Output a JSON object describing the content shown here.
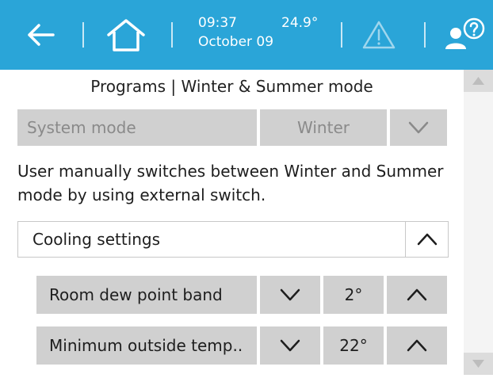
{
  "topbar": {
    "time": "09:37",
    "temperature": "24.9°",
    "date": "October 09",
    "background": "#2aa5d8"
  },
  "page_title": "Programs | Winter & Summer mode",
  "system_mode": {
    "label": "System mode",
    "value": "Winter"
  },
  "description": "User manually switches between Winter and Summer mode by using external switch.",
  "cooling": {
    "label": "Cooling settings"
  },
  "settings": [
    {
      "label": "Room dew point band",
      "value": "2°"
    },
    {
      "label": "Minimum outside temp..",
      "value": "22°"
    }
  ],
  "icons": {
    "back": "arrow-left-icon",
    "home": "home-icon",
    "warning": "warning-icon",
    "help": "user-help-icon",
    "down": "chevron-down-icon",
    "up": "chevron-up-icon"
  }
}
